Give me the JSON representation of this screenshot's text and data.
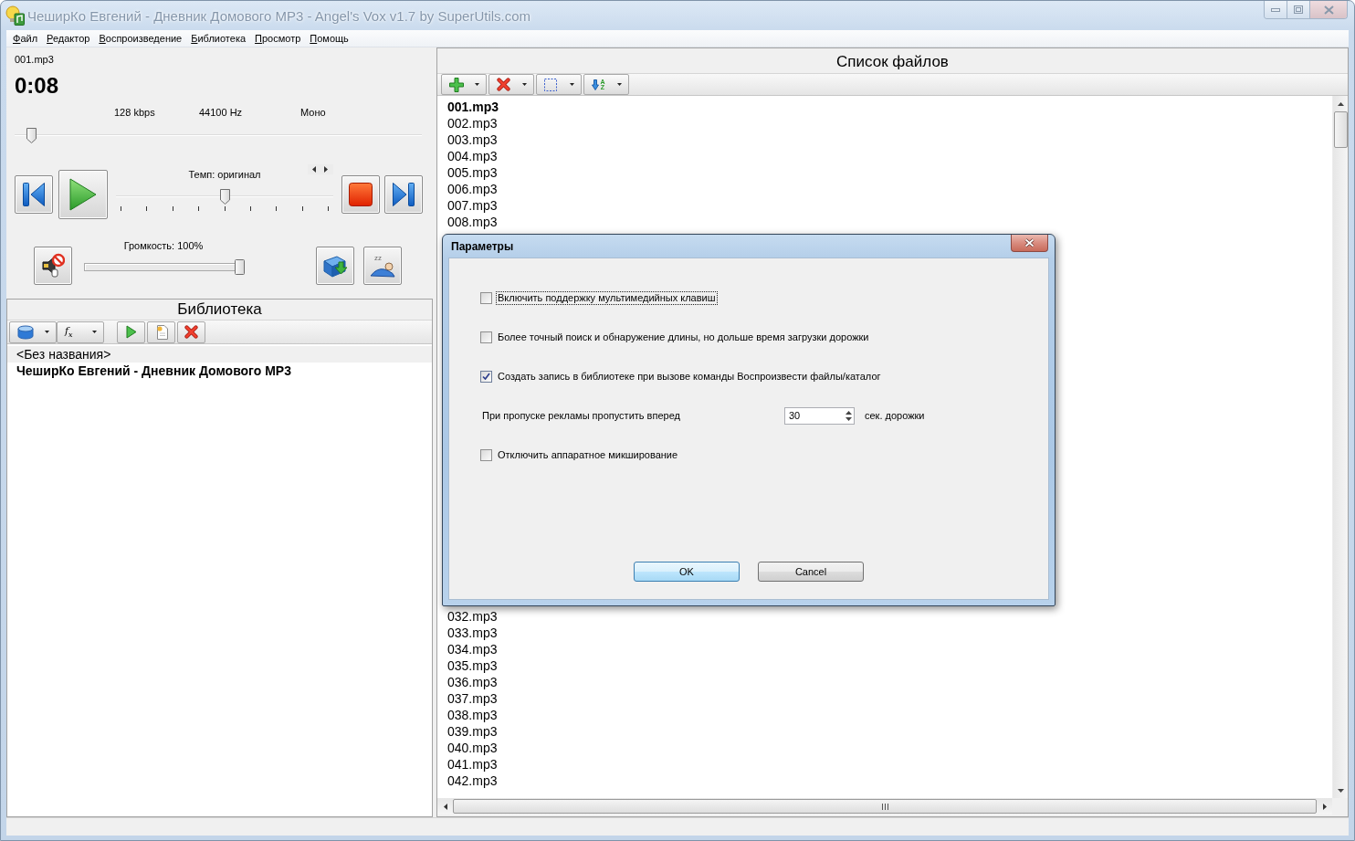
{
  "window": {
    "title": "ЧеширКо Евгений - Дневник Домового MP3 - Angel's Vox v1.7 by SuperUtils.com"
  },
  "menu": [
    "Файл",
    "Редактор",
    "Воспроизведение",
    "Библиотека",
    "Просмотр",
    "Помощь"
  ],
  "player": {
    "file": "001.mp3",
    "time": "0:08",
    "bitrate": "128 kbps",
    "sample_rate": "44100 Hz",
    "channels": "Моно",
    "position": {
      "level": 0.03
    },
    "tempo": {
      "label": "Темп: оригинал",
      "level": 0.5
    },
    "volume": {
      "label": "Громкость: 100%",
      "level": 1
    },
    "sleep_button": {
      "label": "zz"
    }
  },
  "library": {
    "title": "Библиотека",
    "formula_button": {
      "label": "f$_{x}$"
    },
    "items": [
      {
        "label": "<Без названия>",
        "selected": true,
        "current": false
      },
      {
        "label": "ЧеширКо Евгений - Дневник Домового MP3",
        "selected": false,
        "current": true
      }
    ]
  },
  "file_list": {
    "title": "Список файлов",
    "sort_button": {
      "label": "A Z"
    },
    "rows_above_dialog": [
      {
        "name": "001.mp3",
        "current": true
      },
      {
        "name": "002.mp3",
        "current": false
      },
      {
        "name": "003.mp3",
        "current": false
      },
      {
        "name": "004.mp3",
        "current": false
      },
      {
        "name": "005.mp3",
        "current": false
      },
      {
        "name": "006.mp3",
        "current": false
      },
      {
        "name": "007.mp3",
        "current": false
      },
      {
        "name": "008.mp3",
        "current": false
      }
    ],
    "rows_below_dialog": [
      {
        "name": "032.mp3",
        "current": false
      },
      {
        "name": "033.mp3",
        "current": false
      },
      {
        "name": "034.mp3",
        "current": false
      },
      {
        "name": "035.mp3",
        "current": false
      },
      {
        "name": "036.mp3",
        "current": false
      },
      {
        "name": "037.mp3",
        "current": false
      },
      {
        "name": "038.mp3",
        "current": false
      },
      {
        "name": "039.mp3",
        "current": false
      },
      {
        "name": "040.mp3",
        "current": false
      },
      {
        "name": "041.mp3",
        "current": false
      },
      {
        "name": "042.mp3",
        "current": false
      }
    ]
  },
  "dialog": {
    "title": "Параметры",
    "options": [
      {
        "kind": "checkbox",
        "label": "Включить поддержку мультимедийных клавиш",
        "checked": false,
        "focused": true
      },
      {
        "kind": "checkbox",
        "label": "Более точный поиск и обнаружение длины, но дольше время загрузки дорожки",
        "checked": false,
        "focused": false
      },
      {
        "kind": "checkbox",
        "label": "Создать запись в библиотеке при вызове команды Воспроизвести файлы/каталог",
        "checked": true,
        "focused": false
      },
      {
        "kind": "spin",
        "label": "При пропуске рекламы пропустить вперед",
        "value": "30",
        "unit": "сек. дорожки"
      },
      {
        "kind": "checkbox",
        "label": "Отключить аппаратное микширование",
        "checked": false,
        "focused": false
      }
    ],
    "buttons": [
      {
        "label": "OK",
        "default": true
      },
      {
        "label": "Cancel",
        "default": false
      }
    ]
  }
}
